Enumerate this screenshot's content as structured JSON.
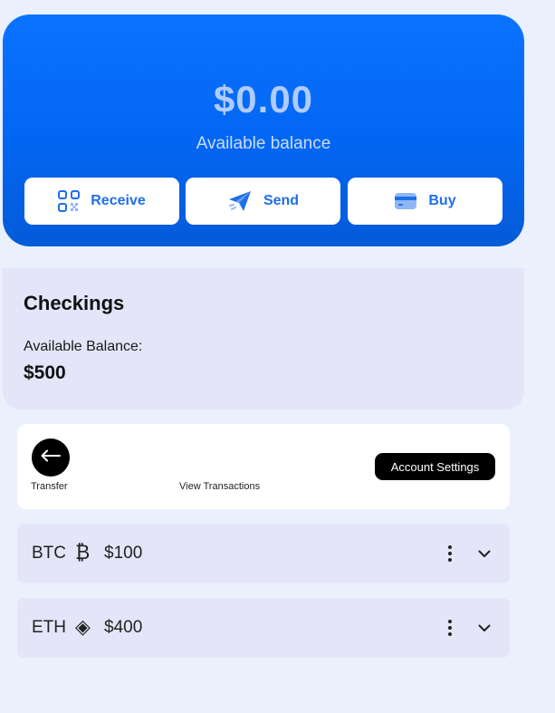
{
  "hero": {
    "balance": "$0.00",
    "subtitle": "Available balance",
    "buttons": {
      "receive": "Receive",
      "send": "Send",
      "buy": "Buy"
    },
    "icons": {
      "receive": "qr-code-icon",
      "send": "paper-plane-icon",
      "buy": "credit-card-icon"
    },
    "colors": {
      "gradient_top": "#0A73FF",
      "gradient_bottom": "#045BD8",
      "button_text": "#1E6FEA"
    }
  },
  "checkings": {
    "title": "Checkings",
    "balance_label": "Available Balance:",
    "balance_value": "$500"
  },
  "account_actions": {
    "transfer_label": "Transfer",
    "transfer_icon": "arrow-left-icon",
    "view_transactions": "View Transactions",
    "account_settings": "Account Settings"
  },
  "holdings": [
    {
      "symbol": "BTC",
      "glyph": "₿",
      "amount": "$100",
      "icon": "bitcoin-icon"
    },
    {
      "symbol": "ETH",
      "glyph": "◈",
      "amount": "$400",
      "icon": "ethereum-icon"
    }
  ]
}
